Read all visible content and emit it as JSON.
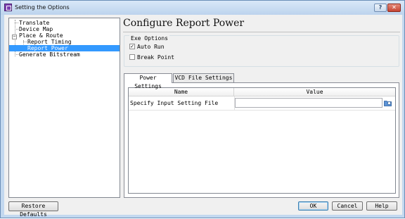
{
  "window": {
    "title": "Setting the Options",
    "help_label": "?",
    "close_label": "✕"
  },
  "tree": {
    "items": [
      {
        "label": "Translate"
      },
      {
        "label": "Device Map"
      },
      {
        "label": "Place & Route",
        "expander": "−"
      },
      {
        "label": "Report Timing"
      },
      {
        "label": "Report Power",
        "selected": true
      },
      {
        "label": "Generate Bitstream"
      }
    ]
  },
  "heading": "Configure Report Power",
  "exe_options": {
    "title": "Exe Options",
    "auto_run": {
      "label": "Auto Run",
      "checked": true,
      "mark": "✓"
    },
    "break_point": {
      "label": "Break Point",
      "checked": false
    }
  },
  "tabs": [
    {
      "label": "Power Settings",
      "active": true
    },
    {
      "label": "VCD File Settings",
      "active": false
    }
  ],
  "table": {
    "columns": [
      "Name",
      "Value"
    ],
    "rows": [
      {
        "name": "Specify Input Setting File",
        "value": ""
      }
    ]
  },
  "buttons": {
    "restore": "Restore Defaults",
    "ok": "OK",
    "cancel": "Cancel",
    "help": "Help"
  },
  "colors": {
    "selection": "#3399ff",
    "title_bar": "#c3d8ef",
    "close_button": "#c64433"
  }
}
